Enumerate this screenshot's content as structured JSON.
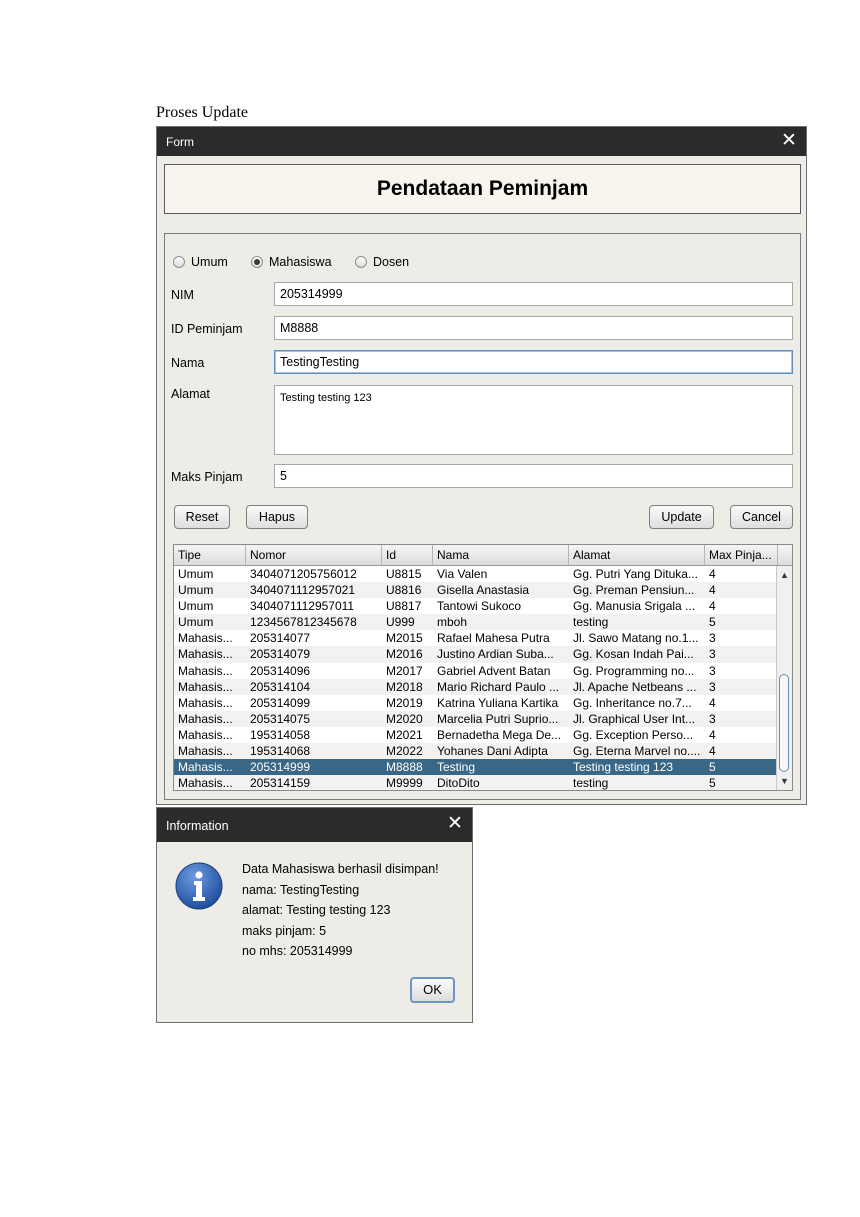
{
  "caption": "Proses Update",
  "form_window": {
    "title": "Form",
    "heading": "Pendataan Peminjam",
    "radio_options": [
      {
        "label": "Umum",
        "selected": false
      },
      {
        "label": "Mahasiswa",
        "selected": true
      },
      {
        "label": "Dosen",
        "selected": false
      }
    ],
    "fields": {
      "nim": {
        "label": "NIM",
        "value": "205314999"
      },
      "id_peminjam": {
        "label": "ID Peminjam",
        "value": "M8888"
      },
      "nama": {
        "label": "Nama",
        "value": "TestingTesting"
      },
      "alamat": {
        "label": "Alamat",
        "value": "Testing testing 123"
      },
      "maks_pinjam": {
        "label": "Maks Pinjam",
        "value": "5"
      }
    },
    "buttons": {
      "reset": "Reset",
      "hapus": "Hapus",
      "update": "Update",
      "cancel": "Cancel"
    },
    "table": {
      "columns": [
        "Tipe",
        "Nomor",
        "Id",
        "Nama",
        "Alamat",
        "Max Pinja..."
      ],
      "selected_row": 12,
      "rows": [
        [
          "Umum",
          "3404071205756012",
          "U8815",
          "Via Valen",
          "Gg. Putri Yang Dituka...",
          "4"
        ],
        [
          "Umum",
          "3404071112957021",
          "U8816",
          "Gisella Anastasia",
          "Gg. Preman Pensiun...",
          "4"
        ],
        [
          "Umum",
          "3404071112957011",
          "U8817",
          "Tantowi Sukoco",
          "Gg. Manusia Srigala ...",
          "4"
        ],
        [
          "Umum",
          "1234567812345678",
          "U999",
          "mboh",
          "testing",
          "5"
        ],
        [
          "Mahasis...",
          "205314077",
          "M2015",
          "Rafael Mahesa Putra",
          "Jl. Sawo Matang no.1...",
          "3"
        ],
        [
          "Mahasis...",
          "205314079",
          "M2016",
          "Justino Ardian Suba...",
          "Gg. Kosan Indah Pai...",
          "3"
        ],
        [
          "Mahasis...",
          "205314096",
          "M2017",
          "Gabriel Advent Batan",
          "Gg. Programming no...",
          "3"
        ],
        [
          "Mahasis...",
          "205314104",
          "M2018",
          "Mario Richard Paulo ...",
          "Jl. Apache Netbeans ...",
          "3"
        ],
        [
          "Mahasis...",
          "205314099",
          "M2019",
          "Katrina Yuliana Kartika",
          "Gg. Inheritance no.7...",
          "4"
        ],
        [
          "Mahasis...",
          "205314075",
          "M2020",
          "Marcelia Putri Suprio...",
          "Jl. Graphical User Int...",
          "3"
        ],
        [
          "Mahasis...",
          "195314058",
          "M2021",
          "Bernadetha Mega De...",
          "Gg. Exception Perso...",
          "4"
        ],
        [
          "Mahasis...",
          "195314068",
          "M2022",
          "Yohanes Dani Adipta",
          "Gg. Eterna Marvel no....",
          "4"
        ],
        [
          "Mahasis...",
          "205314999",
          "M8888",
          "Testing",
          "Testing testing 123",
          "5"
        ],
        [
          "Mahasis...",
          "205314159",
          "M9999",
          "DitoDito",
          "testing",
          "5"
        ]
      ]
    }
  },
  "info_dialog": {
    "title": "Information",
    "icon": "info-icon",
    "message_lines": [
      "Data Mahasiswa berhasil disimpan!",
      "nama: TestingTesting",
      "alamat: Testing testing 123",
      "maks pinjam: 5",
      "no mhs: 205314999"
    ],
    "ok_label": "OK"
  },
  "colors": {
    "titlebar": "#2b2b2b",
    "window_bg": "#eeece6",
    "selection": "#3a6785",
    "info_icon": "#2f63b5"
  }
}
